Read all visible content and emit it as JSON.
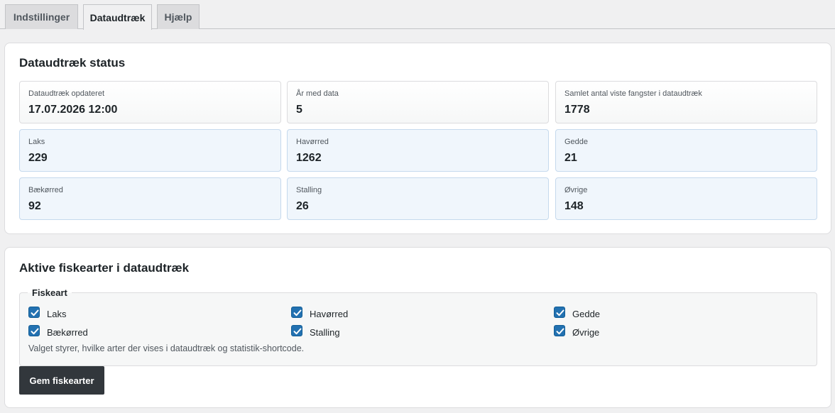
{
  "tabs": [
    {
      "label": "Indstillinger",
      "active": false
    },
    {
      "label": "Dataudtræk",
      "active": true
    },
    {
      "label": "Hjælp",
      "active": false
    }
  ],
  "status": {
    "title": "Dataudtræk status",
    "stats": [
      {
        "label": "Dataudtræk opdateret",
        "value": "17.07.2026 12:00"
      },
      {
        "label": "År med data",
        "value": "5"
      },
      {
        "label": "Samlet antal viste fangster i dataudtræk",
        "value": "1778"
      },
      {
        "label": "Laks",
        "value": "229"
      },
      {
        "label": "Havørred",
        "value": "1262"
      },
      {
        "label": "Gedde",
        "value": "21"
      },
      {
        "label": "Bækørred",
        "value": "92"
      },
      {
        "label": "Stalling",
        "value": "26"
      },
      {
        "label": "Øvrige",
        "value": "148"
      }
    ]
  },
  "species": {
    "title": "Aktive fiskearter i dataudtræk",
    "legend": "Fiskeart",
    "items": [
      {
        "label": "Laks",
        "checked": true
      },
      {
        "label": "Havørred",
        "checked": true
      },
      {
        "label": "Gedde",
        "checked": true
      },
      {
        "label": "Bækørred",
        "checked": true
      },
      {
        "label": "Stalling",
        "checked": true
      },
      {
        "label": "Øvrige",
        "checked": true
      }
    ],
    "hint": "Valget styrer, hvilke arter der vises i dataudtræk og statistik-shortcode.",
    "save_label": "Gem fiskearter"
  },
  "colors": {
    "accent": "#2271b1",
    "button": "#32373c",
    "fish_box_bg": "#f0f6fc"
  }
}
